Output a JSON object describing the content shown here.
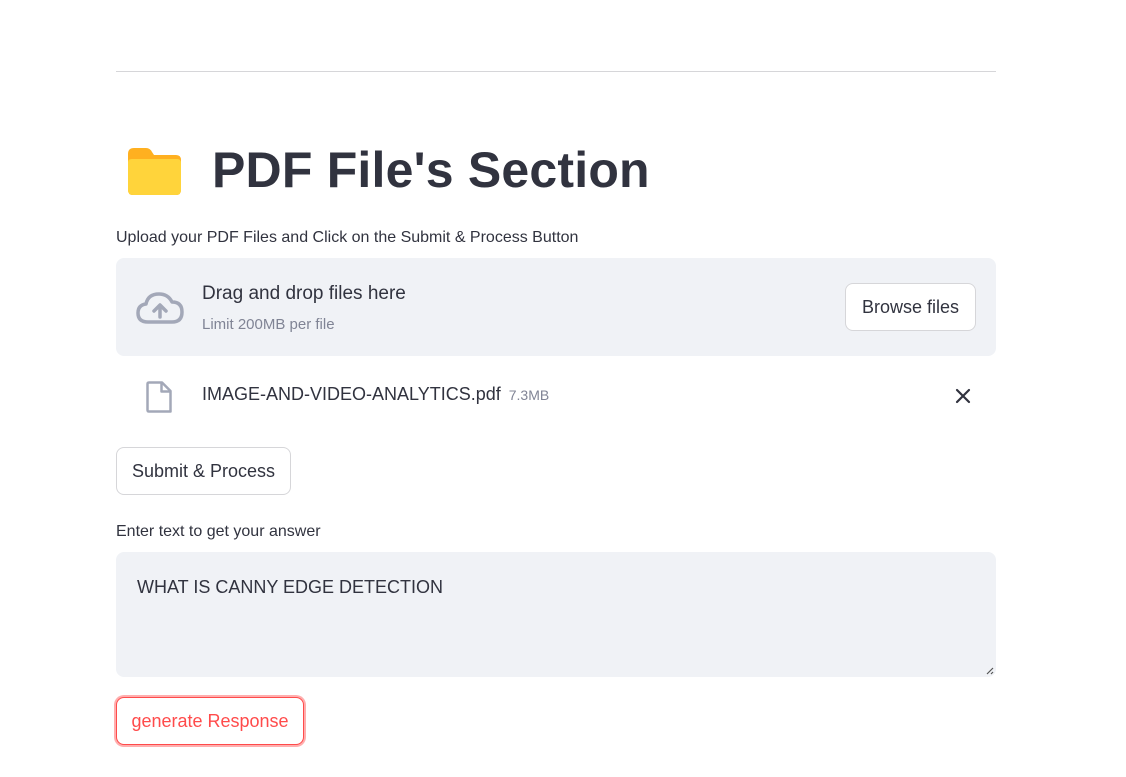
{
  "header": {
    "title": "PDF File's Section",
    "title_icon": "folder-icon"
  },
  "uploader": {
    "label": "Upload your PDF Files and Click on the Submit & Process Button",
    "dropzone_text": "Drag and drop files here",
    "limit_text": "Limit 200MB per file",
    "browse_label": "Browse files",
    "files": [
      {
        "name": "IMAGE-AND-VIDEO-ANALYTICS.pdf",
        "size": "7.3MB"
      }
    ]
  },
  "submit": {
    "label": "Submit & Process"
  },
  "question": {
    "label": "Enter text to get your answer",
    "value": "WHAT IS CANNY EDGE DETECTION"
  },
  "generate": {
    "label": "generate Response"
  },
  "colors": {
    "accent": "#ff4b4b",
    "text": "#31333f",
    "muted": "#808495",
    "surface": "#f0f2f6",
    "folder": "#ffd43b"
  }
}
